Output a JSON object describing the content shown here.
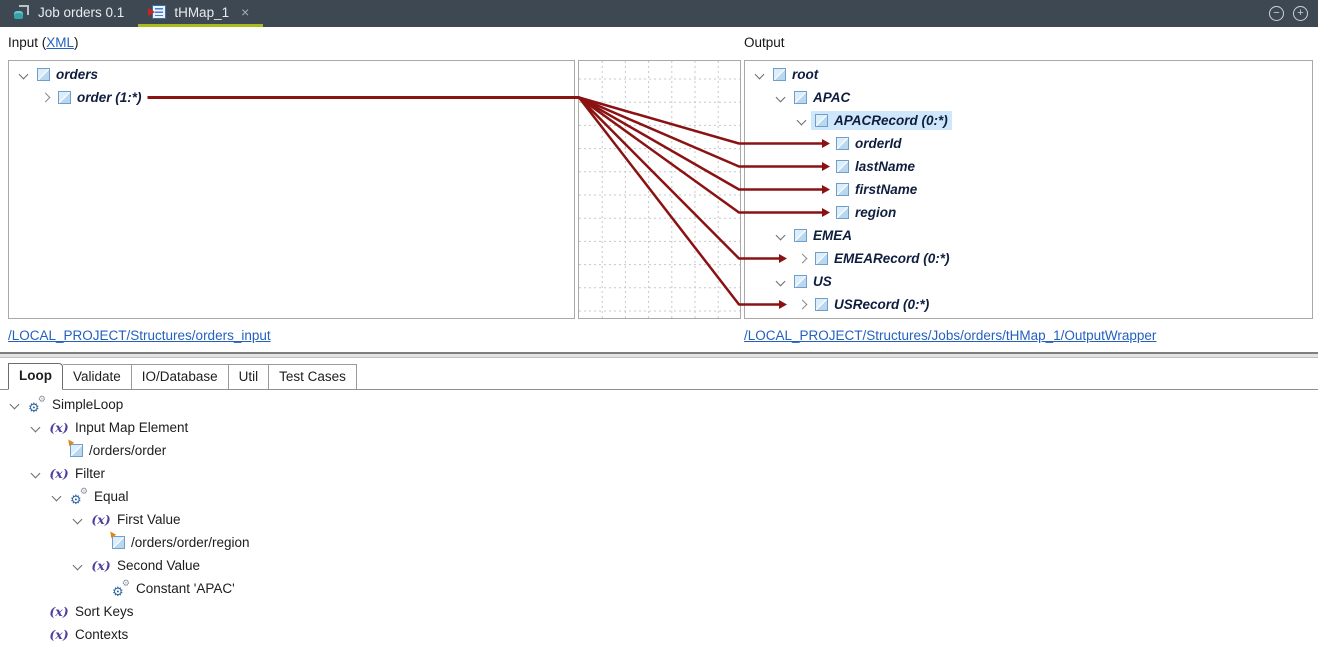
{
  "colors": {
    "topbar_bg": "#3d4852",
    "active_tab_underline": "#a9bc1d",
    "mapping_line": "#8a1212",
    "selection_bg": "#cfe7fa",
    "link_blue": "#2460c0"
  },
  "topbar": {
    "tabs": [
      {
        "label": "Job orders 0.1",
        "icon": "job-icon",
        "active": false,
        "closable": false
      },
      {
        "label": "tHMap_1",
        "icon": "hmap-icon",
        "active": true,
        "closable": true
      }
    ],
    "close_glyph": "×",
    "controls": {
      "collapse": "−",
      "expand": "+"
    }
  },
  "input_panel": {
    "header_prefix": "Input (",
    "header_link": "XML",
    "header_suffix": ")",
    "tree": [
      {
        "label": "orders",
        "depth": 0,
        "chevron": "open",
        "icon": "element"
      },
      {
        "label": "order (1:*)",
        "depth": 1,
        "chevron": "closed",
        "icon": "element",
        "source": true
      }
    ],
    "footer_link": "/LOCAL_PROJECT/Structures/orders_input"
  },
  "output_panel": {
    "header": "Output",
    "tree": [
      {
        "label": "root",
        "depth": 0,
        "chevron": "open",
        "icon": "element"
      },
      {
        "label": "APAC",
        "depth": 1,
        "chevron": "open",
        "icon": "element"
      },
      {
        "label": "APACRecord (0:*)",
        "depth": 2,
        "chevron": "open",
        "icon": "element",
        "selected": true
      },
      {
        "label": "orderId",
        "depth": 3,
        "chevron": "none",
        "icon": "element"
      },
      {
        "label": "lastName",
        "depth": 3,
        "chevron": "none",
        "icon": "element"
      },
      {
        "label": "firstName",
        "depth": 3,
        "chevron": "none",
        "icon": "element"
      },
      {
        "label": "region",
        "depth": 3,
        "chevron": "none",
        "icon": "element"
      },
      {
        "label": "EMEA",
        "depth": 1,
        "chevron": "open",
        "icon": "element"
      },
      {
        "label": "EMEARecord (0:*)",
        "depth": 2,
        "chevron": "closed",
        "icon": "element"
      },
      {
        "label": "US",
        "depth": 1,
        "chevron": "open",
        "icon": "element"
      },
      {
        "label": "USRecord (0:*)",
        "depth": 2,
        "chevron": "closed",
        "icon": "element"
      }
    ],
    "footer_link": "/LOCAL_PROJECT/Structures/Jobs/orders/tHMap_1/OutputWrapper"
  },
  "mapping": {
    "source": "order (1:*)",
    "targets": [
      "orderId",
      "lastName",
      "firstName",
      "region",
      "EMEARecord (0:*)",
      "USRecord (0:*)"
    ]
  },
  "bottom_tabs": [
    {
      "label": "Loop",
      "active": true
    },
    {
      "label": "Validate",
      "active": false
    },
    {
      "label": "IO/Database",
      "active": false
    },
    {
      "label": "Util",
      "active": false
    },
    {
      "label": "Test Cases",
      "active": false
    }
  ],
  "bottom_tree": [
    {
      "label": "SimpleLoop",
      "depth": 0,
      "chevron": "open",
      "icon": "gears"
    },
    {
      "label": "Input Map Element",
      "depth": 1,
      "chevron": "open",
      "icon": "fx"
    },
    {
      "label": "/orders/order",
      "depth": 2,
      "chevron": "none",
      "icon": "element-ref"
    },
    {
      "label": "Filter",
      "depth": 1,
      "chevron": "open",
      "icon": "fx"
    },
    {
      "label": "Equal",
      "depth": 2,
      "chevron": "open",
      "icon": "gears"
    },
    {
      "label": "First Value",
      "depth": 3,
      "chevron": "open",
      "icon": "fx"
    },
    {
      "label": "/orders/order/region",
      "depth": 4,
      "chevron": "none",
      "icon": "element-ref"
    },
    {
      "label": "Second Value",
      "depth": 3,
      "chevron": "open",
      "icon": "fx"
    },
    {
      "label": "Constant 'APAC'",
      "depth": 4,
      "chevron": "none",
      "icon": "gears"
    },
    {
      "label": "Sort Keys",
      "depth": 1,
      "chevron": "none",
      "icon": "fx"
    },
    {
      "label": "Contexts",
      "depth": 1,
      "chevron": "none",
      "icon": "fx"
    }
  ]
}
